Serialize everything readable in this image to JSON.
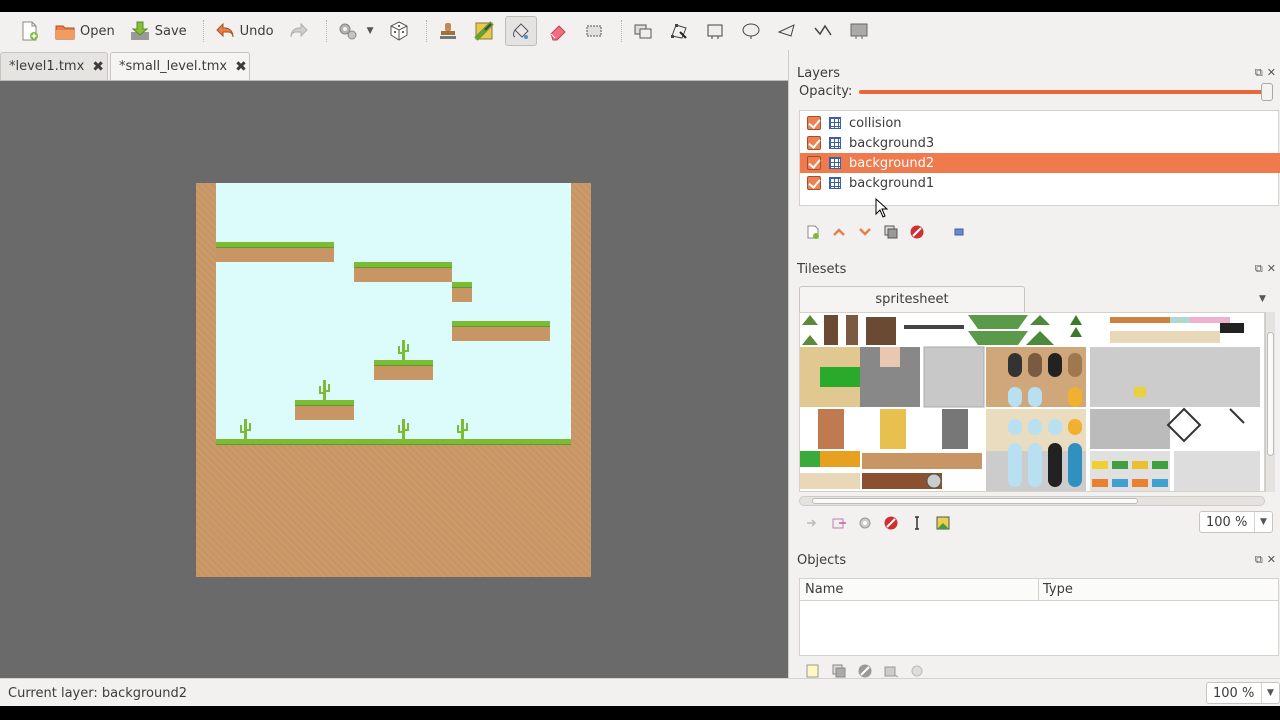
{
  "toolbar": {
    "new_icon": "new-document-icon",
    "open_label": "Open",
    "save_label": "Save",
    "undo_label": "Undo"
  },
  "tabs": [
    {
      "label": "*level1.tmx"
    },
    {
      "label": "*small_level.tmx"
    }
  ],
  "layers_panel": {
    "title": "Layers",
    "opacity_label": "Opacity:",
    "opacity": 1.0,
    "layers": [
      {
        "name": "collision",
        "visible": true,
        "selected": false
      },
      {
        "name": "background3",
        "visible": true,
        "selected": false
      },
      {
        "name": "background2",
        "visible": true,
        "selected": true
      },
      {
        "name": "background1",
        "visible": true,
        "selected": false
      }
    ]
  },
  "tilesets_panel": {
    "title": "Tilesets",
    "tab_label": "spritesheet",
    "zoom": "100 %"
  },
  "objects_panel": {
    "title": "Objects",
    "columns": [
      "Name",
      "Type"
    ]
  },
  "status": {
    "current_layer": "Current layer: background2",
    "zoom": "100 %"
  },
  "colors": {
    "accent": "#ef7a4e",
    "sky": "#dcfcfc",
    "dirt": "#c89664",
    "grass": "#7cbc34",
    "canvas_bg": "#6a6a6a"
  }
}
